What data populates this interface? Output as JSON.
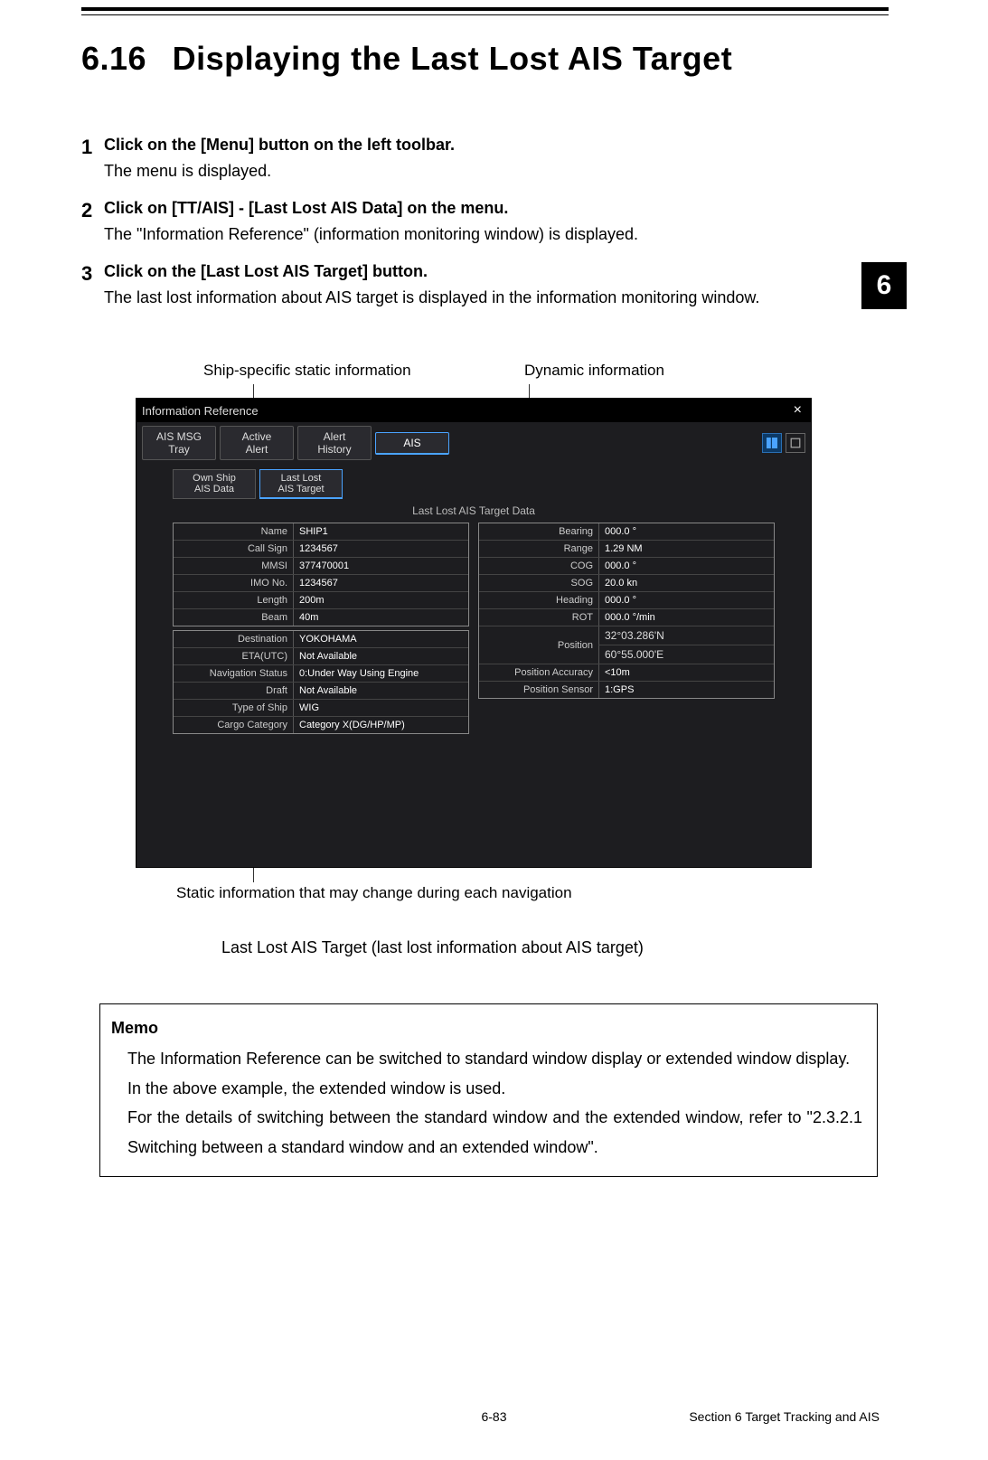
{
  "header": {
    "section_no": "6.16",
    "title": "Displaying the Last Lost AIS Target"
  },
  "side_tab": "6",
  "steps": [
    {
      "num": "1",
      "head": "Click on the [Menu] button on the left toolbar.",
      "body": "The menu is displayed."
    },
    {
      "num": "2",
      "head": "Click on [TT/AIS] - [Last Lost AIS Data] on the menu.",
      "body": "The \"Information Reference\" (information monitoring window) is displayed."
    },
    {
      "num": "3",
      "head": "Click on the [Last Lost AIS Target] button.",
      "body": "The last lost information about AIS target is displayed in the information monitoring window."
    }
  ],
  "callouts": {
    "left": "Ship-specific static information",
    "right": "Dynamic information",
    "below": "Static information that may change during each navigation",
    "figure": "Last Lost AIS Target (last lost information about AIS target)"
  },
  "shot": {
    "window_title": "Information Reference",
    "tabs": {
      "msg_tray": "AIS MSG\nTray",
      "active_alert": "Active\nAlert",
      "alert_history": "Alert\nHistory",
      "ais": "AIS"
    },
    "subtabs": {
      "own": "Own Ship\nAIS Data",
      "lost": "Last Lost\nAIS Target"
    },
    "data_title": "Last Lost AIS Target Data",
    "left_group1": [
      {
        "lbl": "Name",
        "val": "SHIP1"
      },
      {
        "lbl": "Call Sign",
        "val": "1234567"
      },
      {
        "lbl": "MMSI",
        "val": "377470001"
      },
      {
        "lbl": "IMO No.",
        "val": "1234567"
      },
      {
        "lbl": "Length",
        "val": "200m"
      },
      {
        "lbl": "Beam",
        "val": "40m"
      }
    ],
    "left_group2": [
      {
        "lbl": "Destination",
        "val": "YOKOHAMA"
      },
      {
        "lbl": "ETA(UTC)",
        "val": "Not Available"
      },
      {
        "lbl": "Navigation Status",
        "val": "0:Under Way Using Engine"
      },
      {
        "lbl": "Draft",
        "val": "Not Available"
      },
      {
        "lbl": "Type of Ship",
        "val": "WIG"
      },
      {
        "lbl": "Cargo Category",
        "val": "Category X(DG/HP/MP)"
      }
    ],
    "right_group1": [
      {
        "lbl": "Bearing",
        "val": "000.0 °"
      },
      {
        "lbl": "Range",
        "val": "1.29 NM"
      },
      {
        "lbl": "COG",
        "val": "000.0 °"
      },
      {
        "lbl": "SOG",
        "val": "20.0 kn"
      },
      {
        "lbl": "Heading",
        "val": "000.0 °"
      },
      {
        "lbl": "ROT",
        "val": "000.0 °/min"
      }
    ],
    "right_position": {
      "lbl": "Position",
      "v1": "32°03.286'N",
      "v2": "60°55.000'E"
    },
    "right_group2": [
      {
        "lbl": "Position Accuracy",
        "val": "<10m"
      },
      {
        "lbl": "Position Sensor",
        "val": "1:GPS"
      }
    ]
  },
  "memo": {
    "title": "Memo",
    "body": "The Information Reference can be switched to standard window display or extended window display.\nIn the above example, the extended window is used.\nFor the details of switching between the standard window and the extended window, refer to \"2.3.2.1 Switching between a standard window and an extended window\"."
  },
  "footer": {
    "page": "6-83",
    "section": "Section 6    Target Tracking and AIS"
  }
}
